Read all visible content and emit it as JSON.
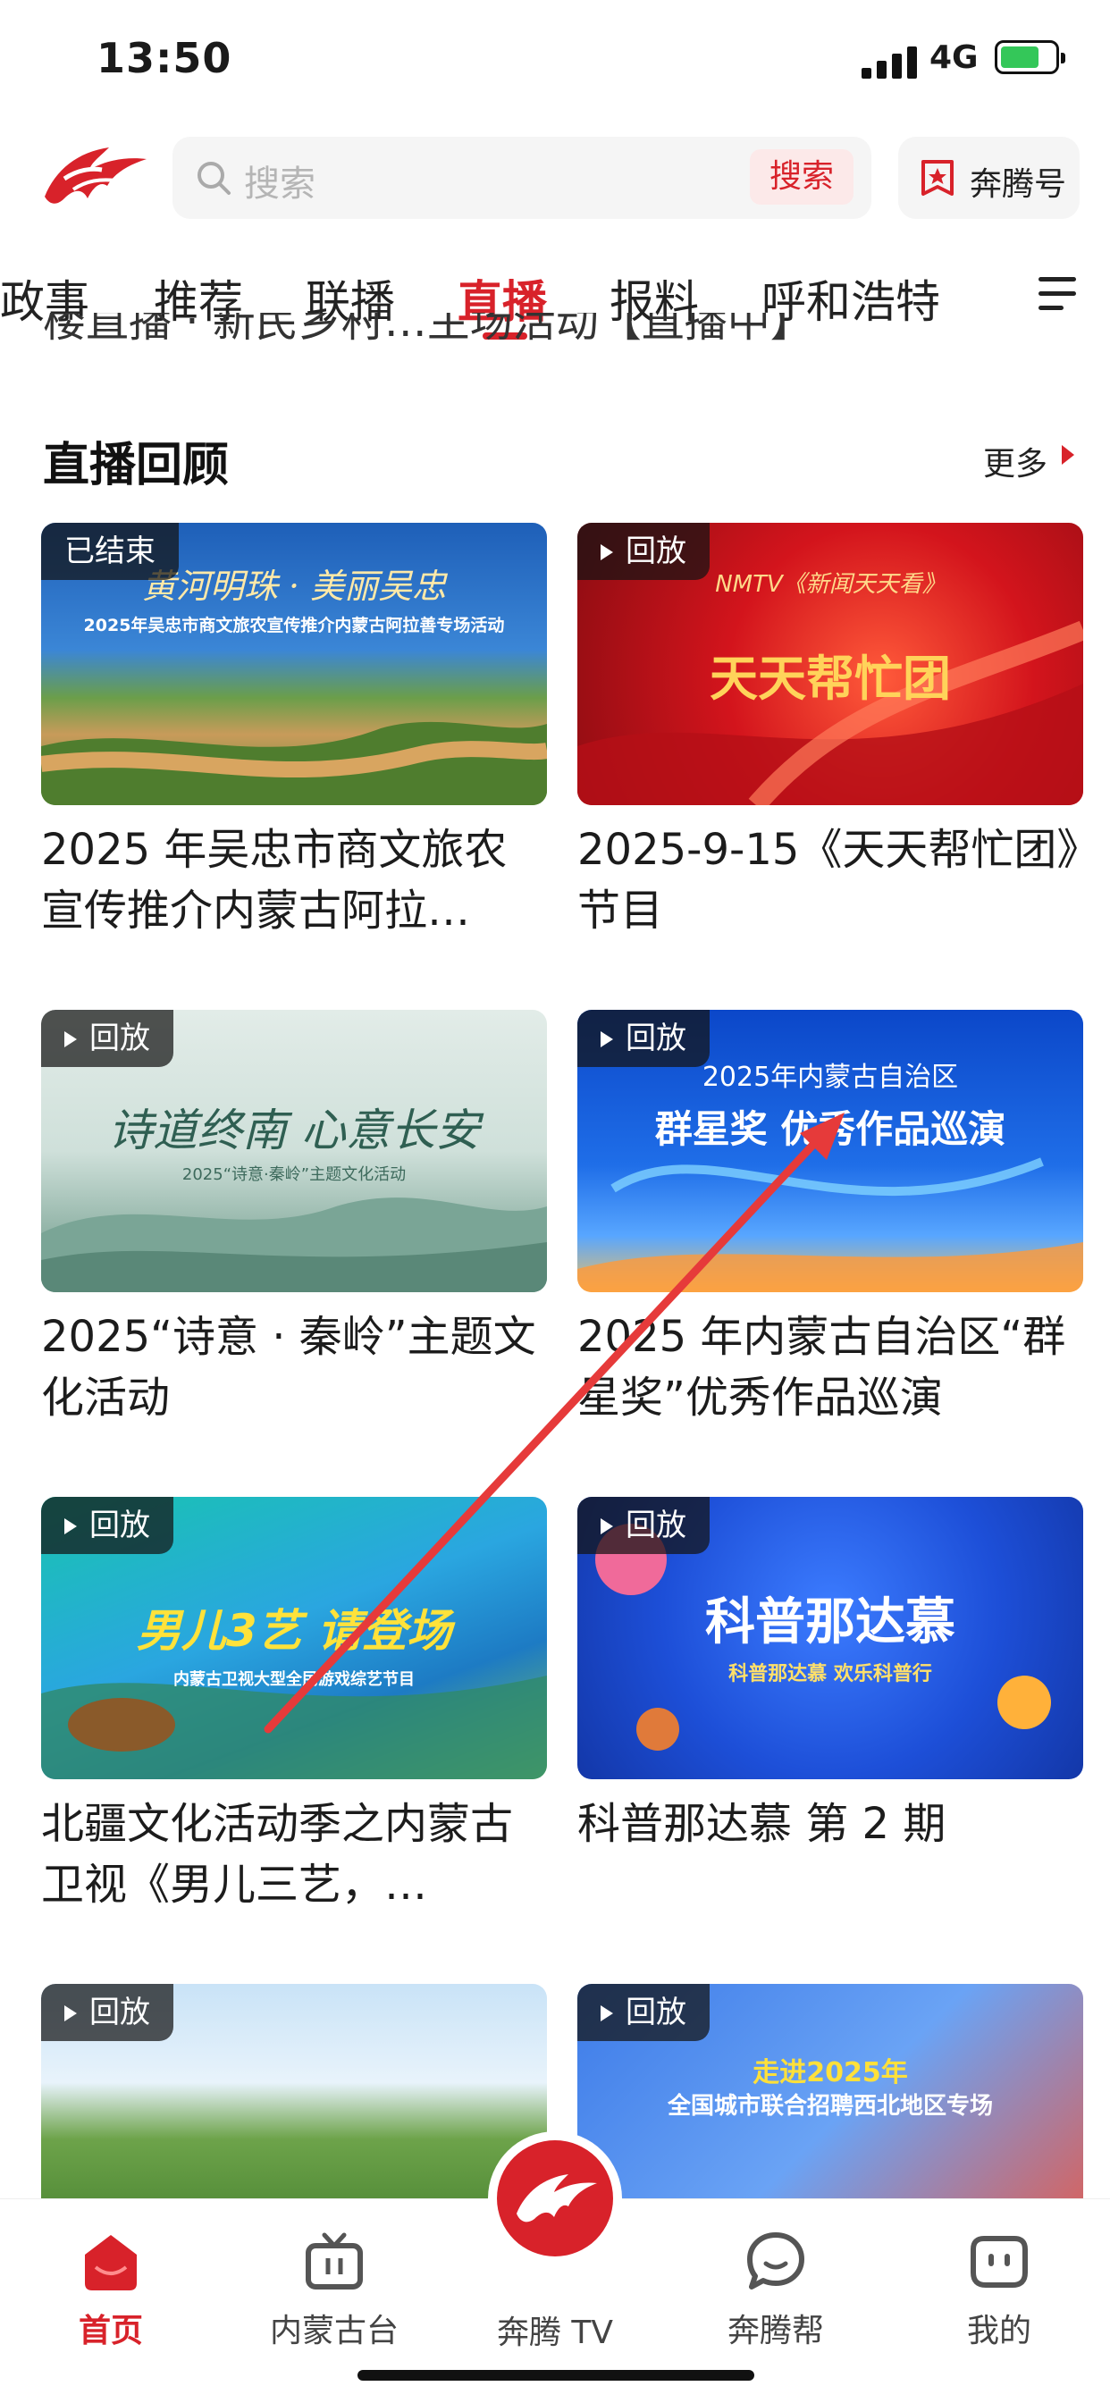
{
  "status_bar": {
    "time": "13:50",
    "network": "4G"
  },
  "header": {
    "search_placeholder": "搜索",
    "search_button": "搜索",
    "benteng_label": "奔腾号"
  },
  "tabs": [
    "政事",
    "推荐",
    "联播",
    "直播",
    "报料",
    "呼和浩特"
  ],
  "active_tab": "直播",
  "partial_text": "楼直播 · 新民乡村…主场活动【直播中】",
  "section": {
    "title": "直播回顾",
    "more": "更多"
  },
  "cards": [
    {
      "badge": "已结束",
      "caption": "2025 年吴忠市商文旅农宣传推介内蒙古阿拉…",
      "thumb_title": "黄河明珠 · 美丽吴忠",
      "thumb_subtitle": "2025年吴忠市商文旅农宣传推介内蒙古阿拉善专场活动"
    },
    {
      "badge": "回放",
      "caption": "2025-9-15《天天帮忙团》节目",
      "thumb_title": "天天帮忙团",
      "thumb_subtitle": "NMTV《新闻天天看》"
    },
    {
      "badge": "回放",
      "caption": "2025“诗意 · 秦岭”主题文化活动",
      "thumb_title": "诗道终南 心意长安",
      "thumb_subtitle": "2025“诗意·秦岭”主题文化活动"
    },
    {
      "badge": "回放",
      "caption": "2025 年内蒙古自治区“群星奖”优秀作品巡演",
      "thumb_title": "群星奖 优秀作品巡演",
      "thumb_subtitle": "2025年内蒙古自治区"
    },
    {
      "badge": "回放",
      "caption": "北疆文化活动季之内蒙古卫视《男儿三艺，…",
      "thumb_title": "男儿3艺 请登场",
      "thumb_subtitle": "内蒙古卫视大型全民游戏综艺节目"
    },
    {
      "badge": "回放",
      "caption": "科普那达慕 第 2 期",
      "thumb_title": "科普那达慕",
      "thumb_subtitle": "科普那达慕 欢乐科普行"
    },
    {
      "badge": "回放",
      "caption": "",
      "thumb_title": "",
      "thumb_subtitle": ""
    },
    {
      "badge": "回放",
      "caption": "",
      "thumb_title": "走进2025年",
      "thumb_subtitle": "全国城市联合招聘西北地区专场"
    }
  ],
  "bottom_nav": [
    {
      "label": "首页",
      "icon": "home-icon"
    },
    {
      "label": "内蒙古台",
      "icon": "tv-icon"
    },
    {
      "label": "奔腾 TV",
      "icon": "benteng-logo-icon"
    },
    {
      "label": "奔腾帮",
      "icon": "chat-icon"
    },
    {
      "label": "我的",
      "icon": "profile-icon"
    }
  ],
  "colors": {
    "accent": "#d8222a"
  }
}
